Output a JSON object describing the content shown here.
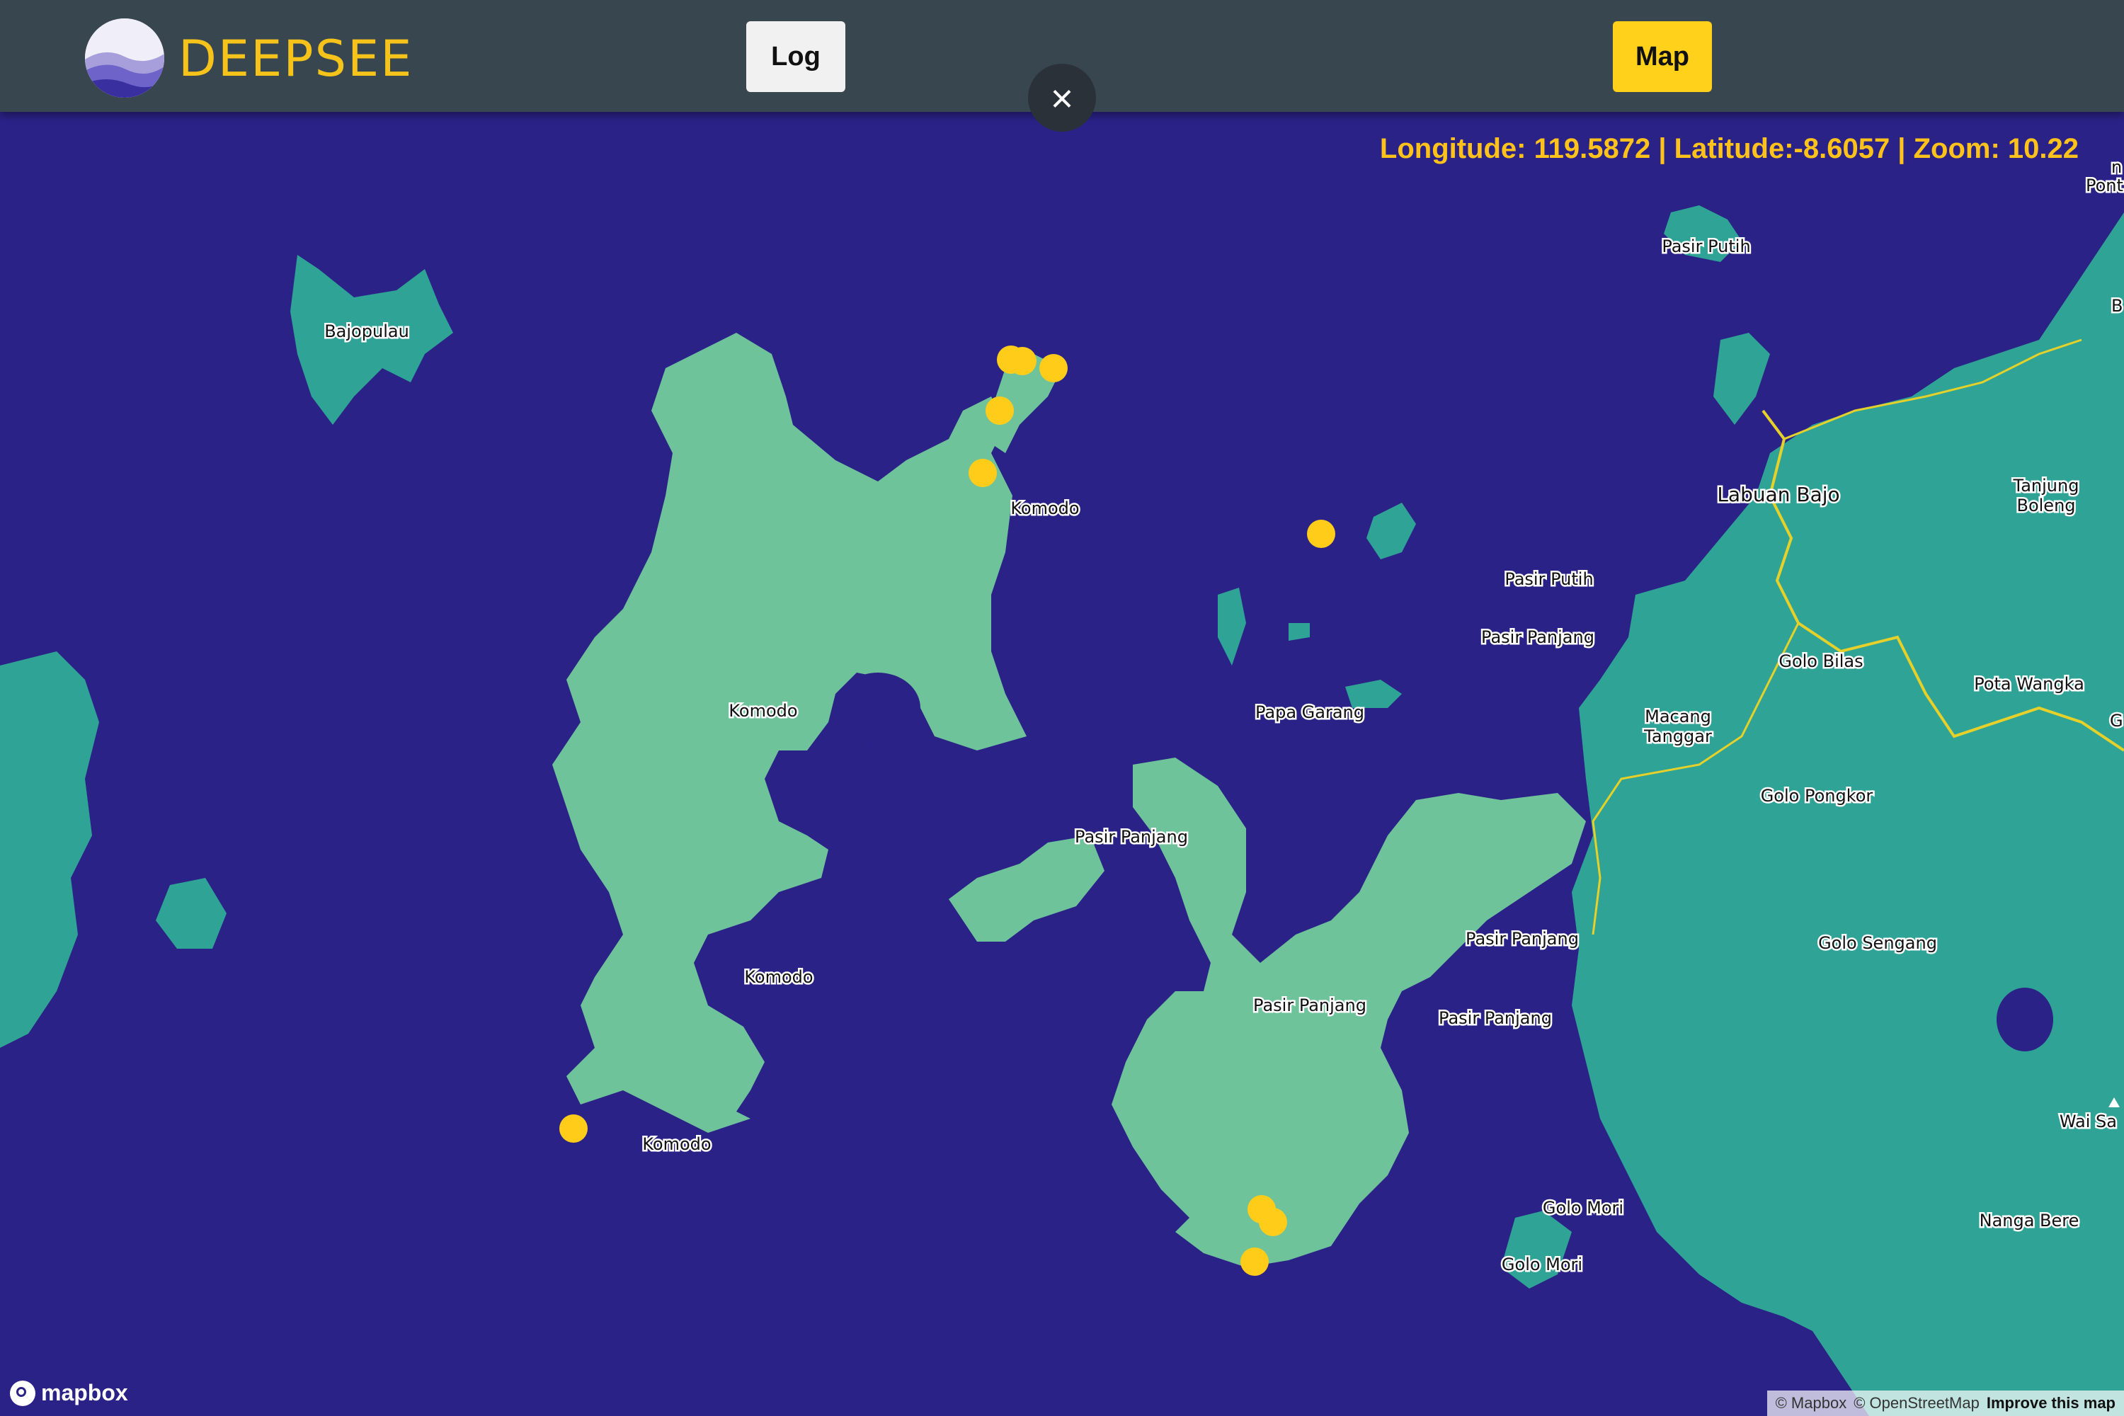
{
  "app": {
    "brand": "DEEPSEE"
  },
  "buttons": {
    "log": "Log",
    "map": "Map",
    "close": "×"
  },
  "status": {
    "coords": "Longitude: 119.5872 | Latitude:-8.6057 | Zoom: 10.22"
  },
  "labels": {
    "bajopulau": "Bajopulau",
    "komodo_n": "Komodo",
    "komodo_c": "Komodo",
    "komodo_s": "Komodo",
    "komodo_sw": "Komodo",
    "pasir_putih_1": "Pasir Putih",
    "pasir_putih_2": "Pasir Putih",
    "pasir_panjang_1": "Pasir Panjang",
    "pasir_panjang_2": "Pasir Panjang",
    "pasir_panjang_3": "Pasir Panjang",
    "pasir_panjang_4": "Pasir Panjang",
    "pasir_panjang_5": "Pasir Panjang",
    "papa_garang": "Papa Garang",
    "labuan_bajo": "Labuan Bajo",
    "tanjung_boleng_1": "Tanjung",
    "tanjung_boleng_2": "Boleng",
    "golo_bilas": "Golo Bilas",
    "pota_wangka": "Pota Wangka",
    "macang_1": "Macang",
    "macang_2": "Tanggar",
    "golo_pongkor": "Golo Pongkor",
    "golo_sengang": "Golo Sengang",
    "golo_mori_1": "Golo Mori",
    "golo_mori_2": "Golo Mori",
    "nanga_bere": "Nanga Bere",
    "wai_sa": "Wai Sa",
    "ponti": "Pont",
    "edge_b": "B",
    "edge_g": "G",
    "edge_n": "n"
  },
  "attribution": {
    "mapbox": "© Mapbox",
    "osm": "© OpenStreetMap",
    "improve": "Improve this map"
  },
  "mapbox_logo": "mapbox",
  "colors": {
    "sea": "#2b2288",
    "land_komodo": "#6fc39a",
    "land_mainland": "#2fa396",
    "marker": "#ffcc1a",
    "topbar": "#37464f",
    "accent": "#f6c31a"
  }
}
